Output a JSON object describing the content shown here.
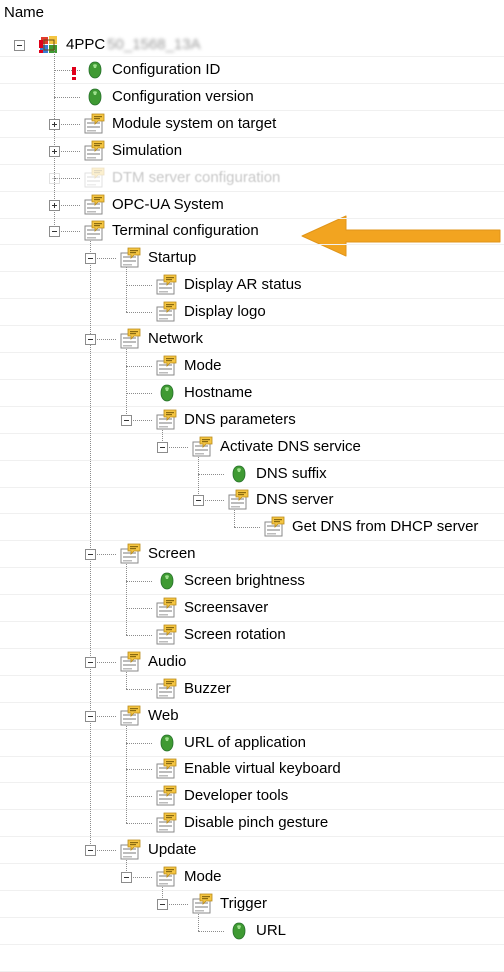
{
  "header": {
    "name_label": "Name"
  },
  "root": {
    "label": "4PPC",
    "label_obscured": "50_1568_13A"
  },
  "colors": {
    "arrow": "#f2a420",
    "leaf_icon": "#3f9a33",
    "folder_yellow": "#f4c542",
    "warning": "#e0001a"
  },
  "icons": {
    "root": "colorful-grid-icon",
    "folder": "settings-folder-icon",
    "value": "green-gem-icon"
  },
  "rows": [
    {
      "label": "Configuration ID",
      "icon": "value",
      "depth": 1,
      "toggle": "none",
      "warning": true
    },
    {
      "label": "Configuration version",
      "icon": "value",
      "depth": 1,
      "toggle": "none"
    },
    {
      "label": "Module system on target",
      "icon": "folder",
      "depth": 1,
      "toggle": "plus"
    },
    {
      "label": "Simulation",
      "icon": "folder",
      "depth": 1,
      "toggle": "plus"
    },
    {
      "label": "DTM server configuration",
      "icon": "folder",
      "depth": 1,
      "toggle": "plus",
      "faded": true
    },
    {
      "label": "OPC-UA System",
      "icon": "folder",
      "depth": 1,
      "toggle": "plus"
    },
    {
      "label": "Terminal configuration",
      "icon": "folder",
      "depth": 1,
      "toggle": "minus",
      "highlighted": true
    },
    {
      "label": "Startup",
      "icon": "folder",
      "depth": 2,
      "toggle": "minus"
    },
    {
      "label": "Display AR status",
      "icon": "folder",
      "depth": 3,
      "toggle": "none"
    },
    {
      "label": "Display logo",
      "icon": "folder",
      "depth": 3,
      "toggle": "none"
    },
    {
      "label": "Network",
      "icon": "folder",
      "depth": 2,
      "toggle": "minus"
    },
    {
      "label": "Mode",
      "icon": "folder",
      "depth": 3,
      "toggle": "none"
    },
    {
      "label": "Hostname",
      "icon": "value",
      "depth": 3,
      "toggle": "none"
    },
    {
      "label": "DNS parameters",
      "icon": "folder",
      "depth": 3,
      "toggle": "minus"
    },
    {
      "label": "Activate DNS service",
      "icon": "folder",
      "depth": 4,
      "toggle": "minus"
    },
    {
      "label": "DNS suffix",
      "icon": "value",
      "depth": 5,
      "toggle": "none"
    },
    {
      "label": "DNS server",
      "icon": "folder",
      "depth": 5,
      "toggle": "minus"
    },
    {
      "label": "Get DNS from DHCP server",
      "icon": "folder",
      "depth": 6,
      "toggle": "none"
    },
    {
      "label": "Screen",
      "icon": "folder",
      "depth": 2,
      "toggle": "minus"
    },
    {
      "label": "Screen brightness",
      "icon": "value",
      "depth": 3,
      "toggle": "none"
    },
    {
      "label": "Screensaver",
      "icon": "folder",
      "depth": 3,
      "toggle": "none"
    },
    {
      "label": "Screen rotation",
      "icon": "folder",
      "depth": 3,
      "toggle": "none"
    },
    {
      "label": "Audio",
      "icon": "folder",
      "depth": 2,
      "toggle": "minus"
    },
    {
      "label": "Buzzer",
      "icon": "folder",
      "depth": 3,
      "toggle": "none"
    },
    {
      "label": "Web",
      "icon": "folder",
      "depth": 2,
      "toggle": "minus"
    },
    {
      "label": "URL of application",
      "icon": "value",
      "depth": 3,
      "toggle": "none"
    },
    {
      "label": "Enable virtual keyboard",
      "icon": "folder",
      "depth": 3,
      "toggle": "none"
    },
    {
      "label": "Developer tools",
      "icon": "folder",
      "depth": 3,
      "toggle": "none"
    },
    {
      "label": "Disable pinch gesture",
      "icon": "folder",
      "depth": 3,
      "toggle": "none"
    },
    {
      "label": "Update",
      "icon": "folder",
      "depth": 2,
      "toggle": "minus"
    },
    {
      "label": "Mode",
      "icon": "folder",
      "depth": 3,
      "toggle": "minus"
    },
    {
      "label": "Trigger",
      "icon": "folder",
      "depth": 4,
      "toggle": "minus"
    },
    {
      "label": "URL",
      "icon": "value",
      "depth": 5,
      "toggle": "none"
    }
  ]
}
